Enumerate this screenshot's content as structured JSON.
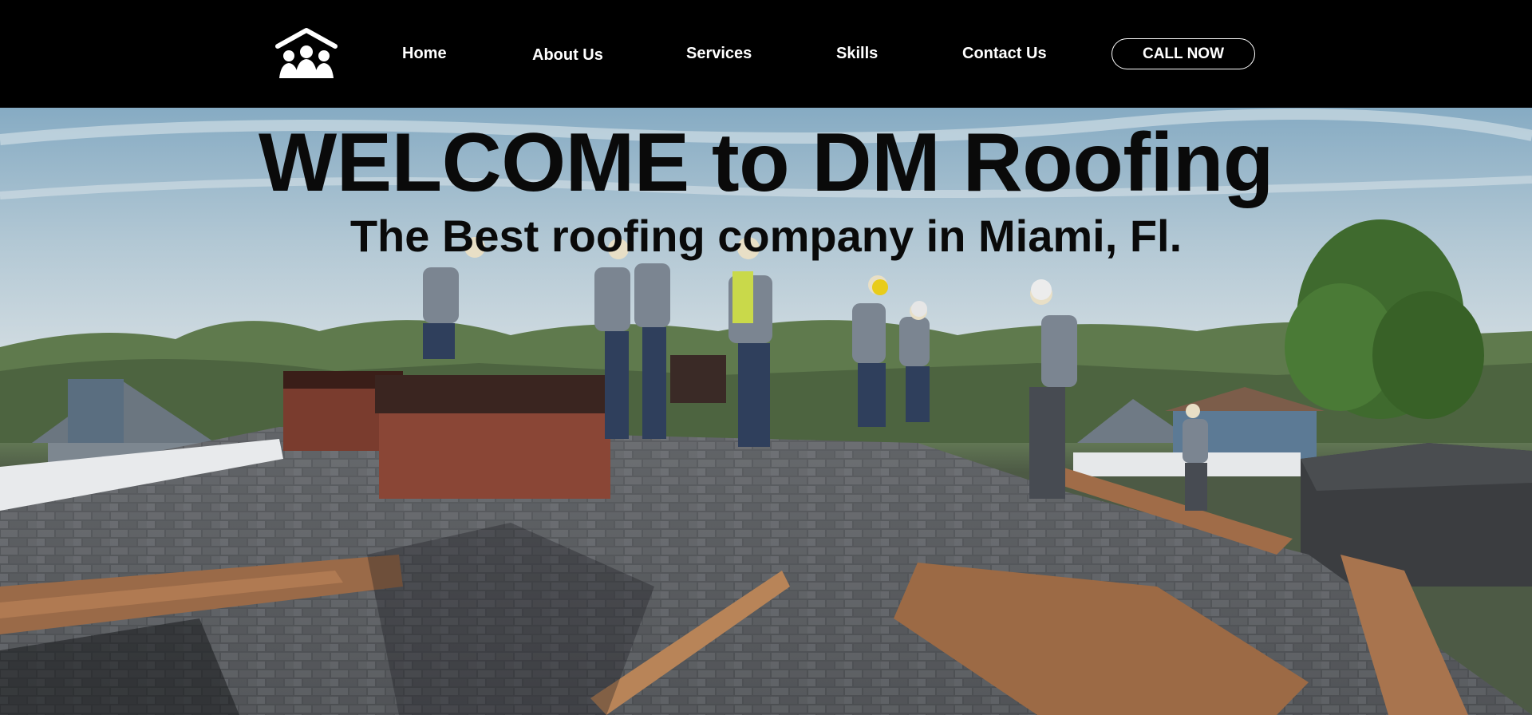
{
  "nav": {
    "home": "Home",
    "about": "About Us",
    "services": "Services",
    "skills": "Skills",
    "contact": "Contact Us",
    "cta": "CALL NOW"
  },
  "logo": {
    "icon": "house-family-icon"
  },
  "hero": {
    "title": "WELCOME to DM Roofing",
    "subtitle": "The Best roofing company in Miami, Fl.",
    "image": "roofers-on-roof-photo"
  },
  "colors": {
    "header_bg": "#000000",
    "header_text": "#ffffff",
    "hero_text": "#0a0a0a"
  }
}
